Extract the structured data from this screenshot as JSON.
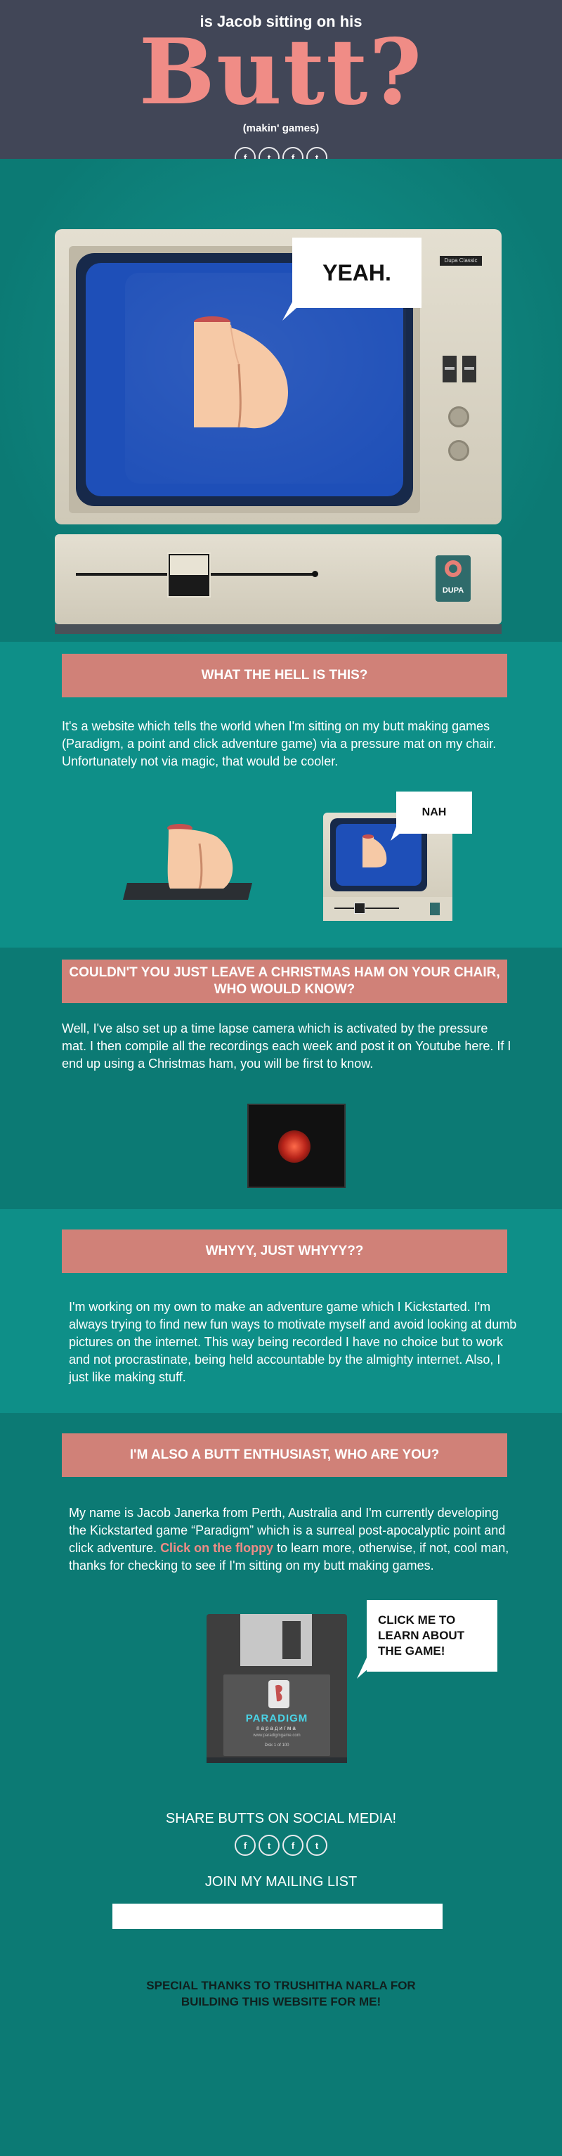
{
  "header": {
    "tagline": "is Jacob sitting on his",
    "title": "Butt?",
    "subtitle": "(makin' games)"
  },
  "social": {
    "icons": [
      "f",
      "t",
      "f",
      "t"
    ],
    "footer_icons": [
      "f",
      "t",
      "f",
      "t"
    ]
  },
  "hero": {
    "status_bubble": "YEAH.",
    "monitor_brand": "Dupa Classic",
    "logo_text": "DUPA"
  },
  "sections": [
    {
      "heading": "WHAT THE HELL IS THIS?",
      "body": "It's a website which tells the world when I'm sitting on my butt making games (Paradigm, a point and click adventure game) via a pressure mat on my chair. Unfortunately not via magic, that would be cooler.",
      "bubble": "NAH"
    },
    {
      "heading": "COULDN'T YOU JUST LEAVE A CHRISTMAS HAM ON YOUR CHAIR, WHO WOULD KNOW?",
      "body": "Well, I've also set up a time lapse camera which is activated by the pressure mat. I then compile all the recordings each week and post it on Youtube here. If I end up using a Christmas ham, you will be first to know."
    },
    {
      "heading": "WHYYY, JUST WHYYY??",
      "body": "I'm working on my own to make an adventure game which I Kickstarted. I'm always trying to find new fun ways to motivate myself and avoid looking at dumb pictures on the internet. This way being recorded I have no choice but to work and not procrastinate, being held accountable by the almighty internet. Also, I just like making stuff."
    },
    {
      "heading": "I'M ALSO A BUTT ENTHUSIAST, WHO ARE YOU?",
      "body_before": "My name is Jacob Janerka from Perth, Australia and I'm currently developing the Kickstarted game “Paradigm” which is a surreal post-apocalyptic  point and click adventure. ",
      "link": "Click on the floppy",
      "body_after": " to learn more, otherwise, if not, cool man, thanks for checking to see if I'm sitting on my butt making games.",
      "bubble": "CLICK ME TO LEARN ABOUT THE GAME!",
      "floppy_title": "PARADIGM",
      "floppy_subtitle": "парадигма",
      "floppy_url": "www.paradigmgame.com",
      "floppy_disk": "Disk 1 of 100"
    }
  ],
  "footer": {
    "share": "SHARE BUTTS ON SOCIAL MEDIA!",
    "mailing": "JOIN MY MAILING LIST",
    "mailing_value": "",
    "thanks": "SPECIAL THANKS TO TRUSHITHA NARLA FOR BUILDING THIS WEBSITE FOR ME!"
  },
  "colors": {
    "header_bg": "#414657",
    "teal": "#0c7a74",
    "teal_light": "#0e8f88",
    "banner": "#d08178",
    "accent": "#f08c86",
    "crt_blue": "#1e4fb8"
  }
}
